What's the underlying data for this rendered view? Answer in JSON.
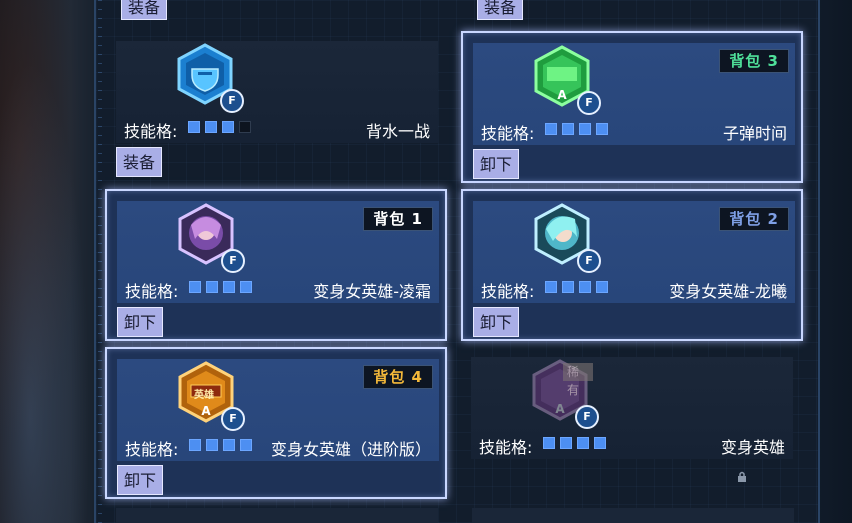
{
  "colors": {
    "slot_filled": "#4d8ff2",
    "slot_empty": "#0d141f",
    "button_bg": "#a9aee6",
    "equipped_border": "#c9d7ff",
    "bag1_color": "#ffffff",
    "bag2_color": "#7fa0e6",
    "bag3_color": "#4fe09a",
    "bag4_color": "#f4b93a"
  },
  "top_row": {
    "left_button": "装备",
    "right_button": "装备"
  },
  "cards": [
    {
      "icon": "shield-hex-icon",
      "badge": "F",
      "slot_label": "技能格:",
      "slots": [
        true,
        true,
        true,
        false
      ],
      "skill_name": "背水一战",
      "button": "装备",
      "bag": ""
    },
    {
      "icon": "bullet-time-hex-icon",
      "badge": "F",
      "slot_label": "技能格:",
      "slots": [
        true,
        true,
        true,
        true
      ],
      "skill_name": "子弹时间",
      "button": "卸下",
      "bag": "背包 3"
    },
    {
      "icon": "hero-linshuang-portrait-icon",
      "badge": "F",
      "slot_label": "技能格:",
      "slots": [
        true,
        true,
        true,
        true
      ],
      "skill_name": "变身女英雄-凌霜",
      "button": "卸下",
      "bag": "背包 1"
    },
    {
      "icon": "hero-longxi-portrait-icon",
      "badge": "F",
      "slot_label": "技能格:",
      "slots": [
        true,
        true,
        true,
        true
      ],
      "skill_name": "变身女英雄-龙曦",
      "button": "卸下",
      "bag": "背包 2"
    },
    {
      "icon": "hero-advanced-hex-icon",
      "badge": "F",
      "icon_text": "英雄",
      "slot_label": "技能格:",
      "slots": [
        true,
        true,
        true,
        true
      ],
      "skill_name": "变身女英雄（进阶版）",
      "button": "卸下",
      "bag": "背包 4"
    },
    {
      "icon": "hero-locked-hex-icon",
      "badge": "F",
      "rare_tag": "稀有",
      "slot_label": "技能格:",
      "slots": [
        true,
        true,
        true,
        true
      ],
      "skill_name": "变身英雄",
      "button": "",
      "bag": "",
      "locked": true
    }
  ]
}
